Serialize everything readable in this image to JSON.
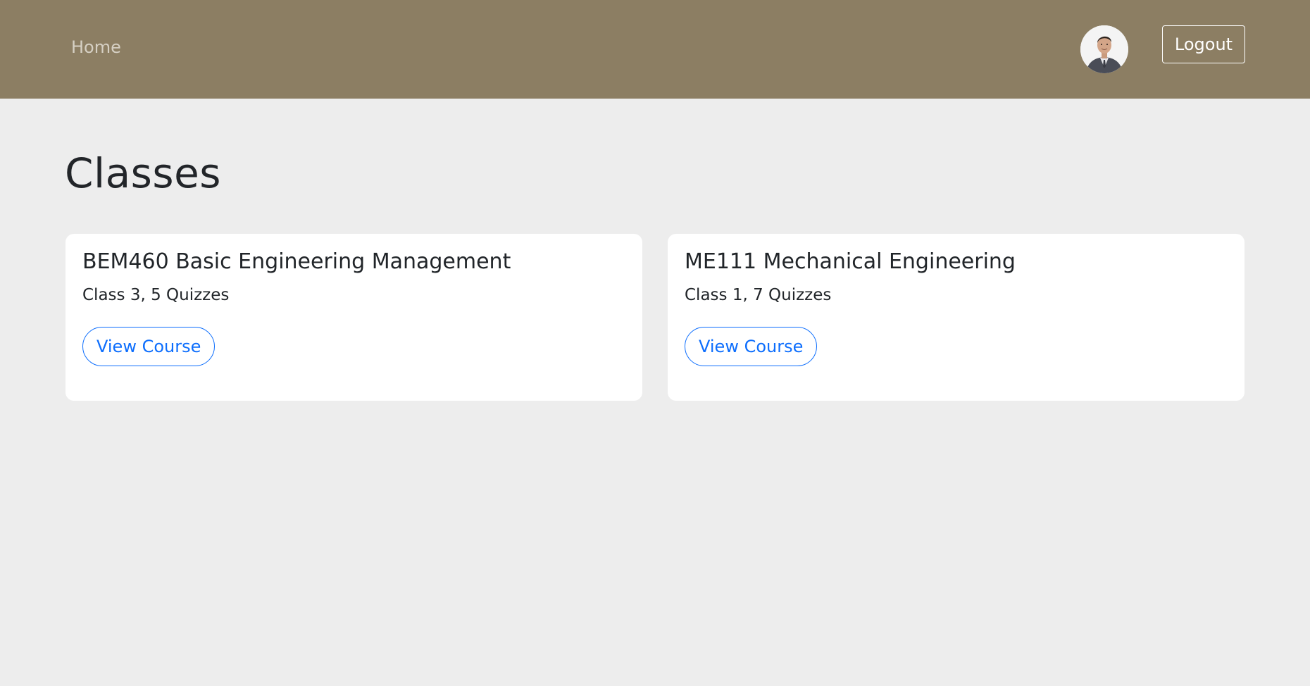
{
  "navbar": {
    "home_label": "Home",
    "logout_label": "Logout",
    "avatar_icon": "user-avatar"
  },
  "page": {
    "title": "Classes"
  },
  "classes": [
    {
      "title": "BEM460 Basic Engineering Management",
      "subtitle": "Class 3, 5 Quizzes",
      "button_label": "View Course"
    },
    {
      "title": "ME111 Mechanical Engineering",
      "subtitle": "Class 1, 7 Quizzes",
      "button_label": "View Course"
    }
  ],
  "colors": {
    "navbar_bg": "#8c7e63",
    "page_bg": "#ededed",
    "accent": "#0d6efd"
  }
}
